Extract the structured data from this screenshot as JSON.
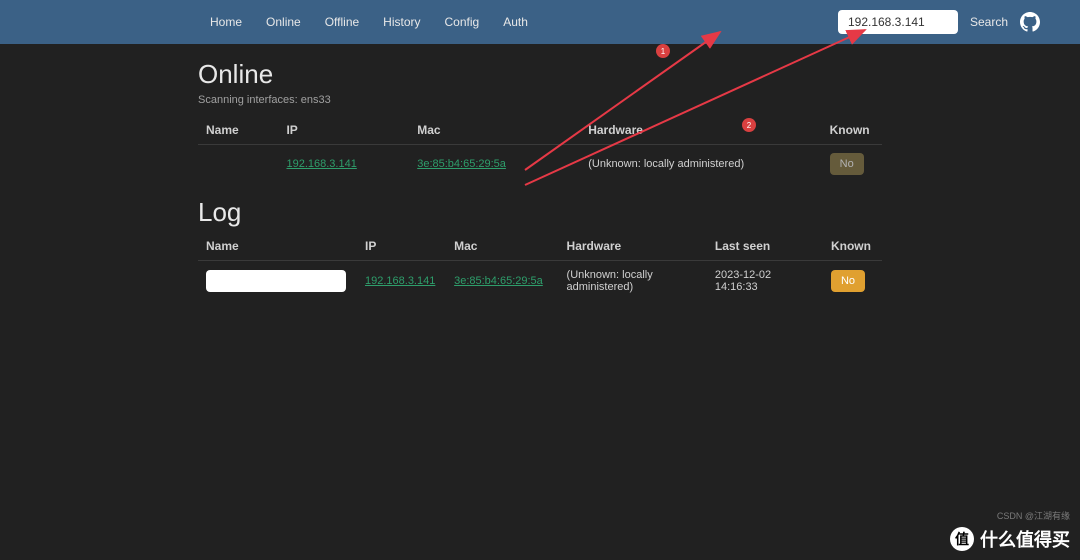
{
  "nav": {
    "links": [
      "Home",
      "Online",
      "Offline",
      "History",
      "Config",
      "Auth"
    ],
    "search_value": "192.168.3.141",
    "search_label": "Search"
  },
  "online": {
    "title": "Online",
    "subtitle": "Scanning interfaces: ens33",
    "headers": {
      "name": "Name",
      "ip": "IP",
      "mac": "Mac",
      "hardware": "Hardware",
      "known": "Known"
    },
    "row": {
      "name": "",
      "ip": "192.168.3.141",
      "mac": "3e:85:b4:65:29:5a",
      "hardware": "(Unknown: locally administered)",
      "known": "No"
    }
  },
  "log": {
    "title": "Log",
    "headers": {
      "name": "Name",
      "ip": "IP",
      "mac": "Mac",
      "hardware": "Hardware",
      "lastseen": "Last seen",
      "known": "Known"
    },
    "row": {
      "filter": "",
      "ip": "192.168.3.141",
      "mac": "3e:85:b4:65:29:5a",
      "hardware": "(Unknown: locally administered)",
      "lastseen": "2023-12-02 14:16:33",
      "known": "No"
    }
  },
  "annotations": {
    "badge1": "1",
    "badge2": "2"
  },
  "watermark": {
    "circle": "值",
    "text": "什么值得买",
    "sub": "CSDN @江湖有缘"
  }
}
